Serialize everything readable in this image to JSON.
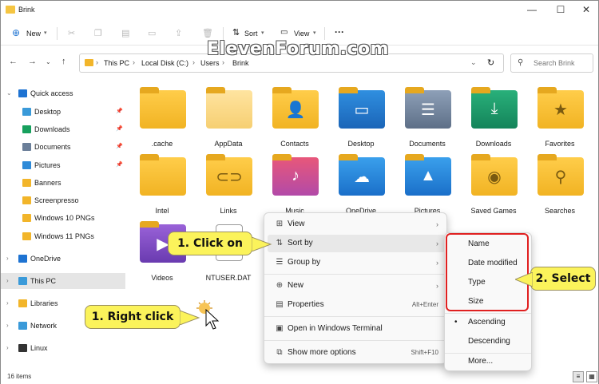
{
  "window": {
    "title": "Brink",
    "controls": [
      "—",
      "☐",
      "✕"
    ]
  },
  "toolbar": {
    "new_label": "New",
    "sort_label": "Sort",
    "view_label": "View",
    "more_label": "···"
  },
  "address": {
    "crumbs": [
      "This PC",
      "Local Disk (C:)",
      "Users",
      "Brink"
    ],
    "search_placeholder": "Search Brink",
    "watermark": "ElevenForum.com"
  },
  "sidebar": {
    "items": [
      {
        "label": "Quick access",
        "icon": "star-icon",
        "color": "#1e73d2",
        "pinned": false
      },
      {
        "label": "Desktop",
        "icon": "desktop-icon",
        "color": "#3a9ad9",
        "pinned": true
      },
      {
        "label": "Downloads",
        "icon": "download-icon",
        "color": "#17a05d",
        "pinned": true
      },
      {
        "label": "Documents",
        "icon": "document-icon",
        "color": "#6b7f99",
        "pinned": true
      },
      {
        "label": "Pictures",
        "icon": "pictures-icon",
        "color": "#2e8ad8",
        "pinned": true
      },
      {
        "label": "Banners",
        "icon": "folder-icon",
        "color": "#f2b52a",
        "pinned": false
      },
      {
        "label": "Screenpresso",
        "icon": "folder-icon",
        "color": "#f2b52a",
        "pinned": false
      },
      {
        "label": "Windows 10 PNGs",
        "icon": "folder-icon",
        "color": "#f2b52a",
        "pinned": false
      },
      {
        "label": "Windows 11 PNGs",
        "icon": "folder-icon",
        "color": "#f2b52a",
        "pinned": false
      },
      {
        "label": "OneDrive",
        "icon": "cloud-icon",
        "color": "#1e73d2",
        "pinned": false
      },
      {
        "label": "This PC",
        "icon": "pc-icon",
        "color": "#3a9ad9",
        "pinned": false
      },
      {
        "label": "Libraries",
        "icon": "library-icon",
        "color": "#f2b52a",
        "pinned": false
      },
      {
        "label": "Network",
        "icon": "network-icon",
        "color": "#3a9ad9",
        "pinned": false
      },
      {
        "label": "Linux",
        "icon": "linux-icon",
        "color": "#333333",
        "pinned": false
      }
    ]
  },
  "files": [
    {
      "label": ".cache",
      "glyph": ""
    },
    {
      "label": "AppData",
      "glyph": ""
    },
    {
      "label": "Contacts",
      "glyph": "👤"
    },
    {
      "label": "Desktop",
      "glyph": "▭"
    },
    {
      "label": "Documents",
      "glyph": "☰"
    },
    {
      "label": "Downloads",
      "glyph": "⤓"
    },
    {
      "label": "Favorites",
      "glyph": "★"
    },
    {
      "label": "Intel",
      "glyph": ""
    },
    {
      "label": "Links",
      "glyph": "⊂⊃"
    },
    {
      "label": "Music",
      "glyph": "♪"
    },
    {
      "label": "OneDrive",
      "glyph": "☁"
    },
    {
      "label": "Pictures",
      "glyph": "▲"
    },
    {
      "label": "Saved Games",
      "glyph": "◉"
    },
    {
      "label": "Searches",
      "glyph": "⚲"
    },
    {
      "label": "Videos",
      "glyph": "▶"
    },
    {
      "label": "NTUSER.DAT",
      "glyph": ""
    }
  ],
  "context_menu": {
    "items": [
      {
        "label": "View",
        "icon": "view-icon",
        "glyph": "⊞",
        "arrow": "›",
        "shortcut": ""
      },
      {
        "label": "Sort by",
        "icon": "sort-icon",
        "glyph": "⇅",
        "arrow": "›",
        "shortcut": ""
      },
      {
        "label": "Group by",
        "icon": "group-icon",
        "glyph": "☰",
        "arrow": "›",
        "shortcut": ""
      },
      {
        "label": "New",
        "icon": "new-icon",
        "glyph": "⊕",
        "arrow": "›",
        "shortcut": ""
      },
      {
        "label": "Properties",
        "icon": "properties-icon",
        "glyph": "▤",
        "arrow": "",
        "shortcut": "Alt+Enter"
      },
      {
        "label": "Open in Windows Terminal",
        "icon": "terminal-icon",
        "glyph": "▣",
        "arrow": "",
        "shortcut": ""
      },
      {
        "label": "Show more options",
        "icon": "more-options-icon",
        "glyph": "⧉",
        "arrow": "",
        "shortcut": "Shift+F10"
      }
    ]
  },
  "sort_submenu": {
    "items": [
      "Name",
      "Date modified",
      "Type",
      "Size",
      "Ascending",
      "Descending",
      "More..."
    ],
    "selected_order": "Ascending"
  },
  "callouts": {
    "click_on": "1. Click on",
    "select": "2. Select",
    "right_click": "1. Right click"
  },
  "status": {
    "item_count": "16 items"
  },
  "colors": {
    "callout": "#fbf35b",
    "highlight_box": "#e02020",
    "folder": "#f2b52a"
  }
}
